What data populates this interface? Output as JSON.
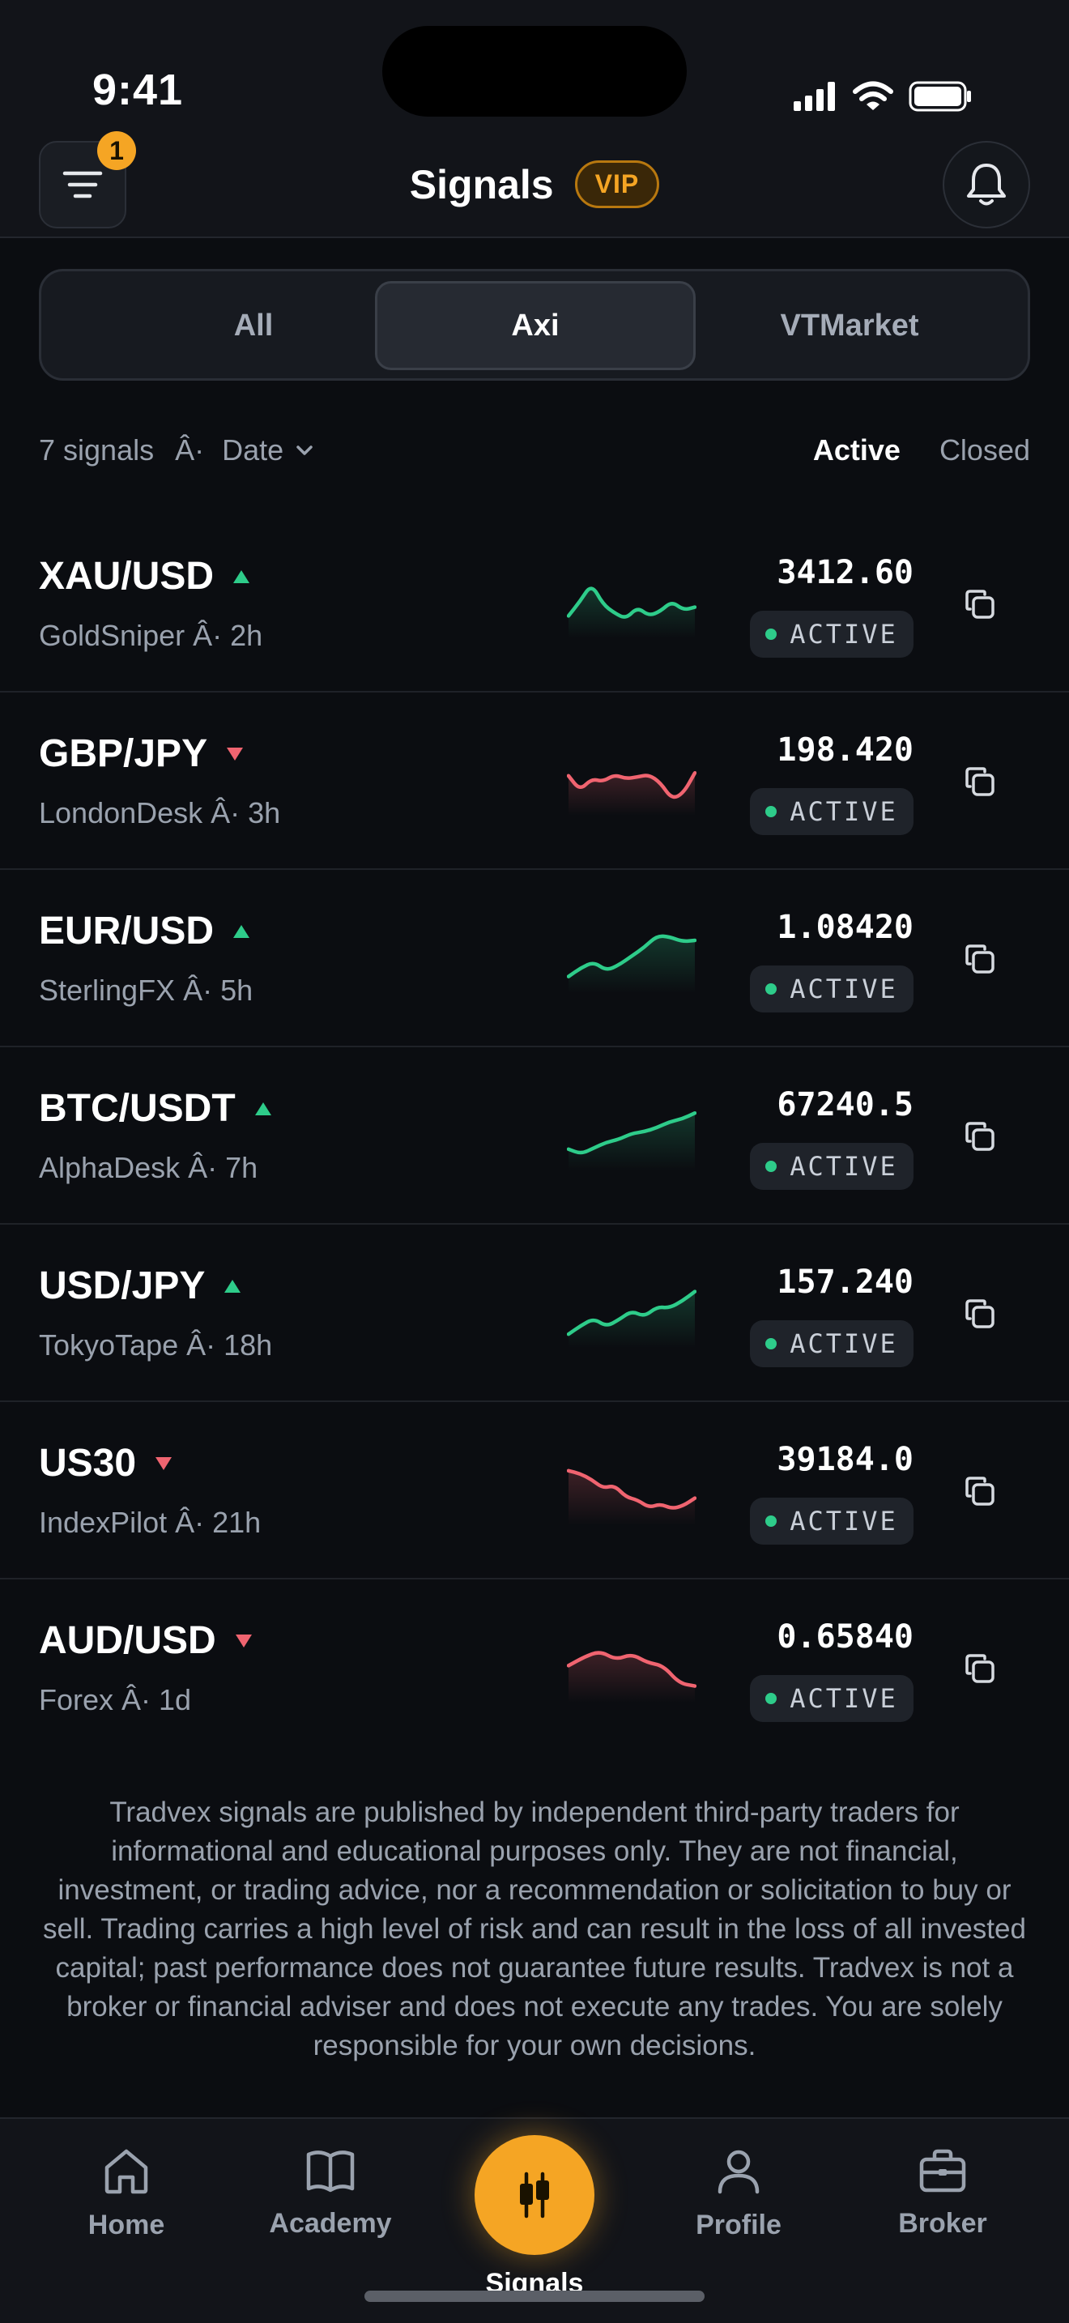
{
  "status_bar": {
    "time": "9:41"
  },
  "header": {
    "title": "Signals",
    "badge": "VIP",
    "filter_count": "1"
  },
  "tabs": [
    {
      "label": "All",
      "selected": false
    },
    {
      "label": "Axi",
      "selected": true
    },
    {
      "label": "VTMarket",
      "selected": false
    }
  ],
  "filter_row": {
    "count_text": "7 signals",
    "separator": "Â·",
    "sort_label": "Date",
    "toggle_active": "Active",
    "toggle_closed": "Closed"
  },
  "signals": [
    {
      "pair": "XAU/USD",
      "direction": "up",
      "meta": "GoldSniper Â· 2h",
      "price": "3412.60",
      "status": "ACTIVE",
      "spark": [
        0.3,
        0.55,
        0.85,
        0.5,
        0.35,
        0.25,
        0.45,
        0.3,
        0.38,
        0.55,
        0.4,
        0.45
      ]
    },
    {
      "pair": "GBP/JPY",
      "direction": "down",
      "meta": "LondonDesk Â· 3h",
      "price": "198.420",
      "status": "ACTIVE",
      "spark": [
        0.6,
        0.35,
        0.55,
        0.5,
        0.62,
        0.55,
        0.58,
        0.62,
        0.48,
        0.2,
        0.3,
        0.65
      ]
    },
    {
      "pair": "EUR/USD",
      "direction": "up",
      "meta": "SterlingFX Â· 5h",
      "price": "1.08420",
      "status": "ACTIVE",
      "spark": [
        0.2,
        0.35,
        0.45,
        0.3,
        0.4,
        0.55,
        0.7,
        0.9,
        0.88,
        0.8,
        0.82
      ]
    },
    {
      "pair": "BTC/USDT",
      "direction": "up",
      "meta": "AlphaDesk Â· 7h",
      "price": "67240.5",
      "status": "ACTIVE",
      "spark": [
        0.28,
        0.2,
        0.3,
        0.4,
        0.45,
        0.55,
        0.58,
        0.65,
        0.75,
        0.8,
        0.9
      ]
    },
    {
      "pair": "USD/JPY",
      "direction": "up",
      "meta": "TokyoTape Â· 18h",
      "price": "157.240",
      "status": "ACTIVE",
      "spark": [
        0.15,
        0.3,
        0.42,
        0.28,
        0.4,
        0.55,
        0.45,
        0.62,
        0.6,
        0.72,
        0.88
      ]
    },
    {
      "pair": "US30",
      "direction": "down",
      "meta": "IndexPilot Â· 21h",
      "price": "39184.0",
      "status": "ACTIVE",
      "spark": [
        0.85,
        0.8,
        0.7,
        0.55,
        0.6,
        0.4,
        0.35,
        0.22,
        0.28,
        0.2,
        0.25,
        0.38
      ]
    },
    {
      "pair": "AUD/USD",
      "direction": "down",
      "meta": "Forex Â· 1d",
      "price": "0.65840",
      "status": "ACTIVE",
      "spark": [
        0.55,
        0.7,
        0.8,
        0.65,
        0.75,
        0.6,
        0.55,
        0.25,
        0.2
      ]
    }
  ],
  "colors": {
    "up": "#2ecc8a",
    "down": "#f06470",
    "accent": "#f5a524"
  },
  "disclaimer": "Tradvex signals are published by independent third-party traders for informational and educational purposes only. They are not financial, investment, or trading advice, nor a recommendation or solicitation to buy or sell. Trading carries a high level of risk and can result in the loss of all invested capital; past performance does not guarantee future results. Tradvex is not a broker or financial adviser and does not execute any trades. You are solely responsible for your own decisions.",
  "nav": {
    "home": "Home",
    "academy": "Academy",
    "signals": "Signals",
    "profile": "Profile",
    "broker": "Broker"
  }
}
